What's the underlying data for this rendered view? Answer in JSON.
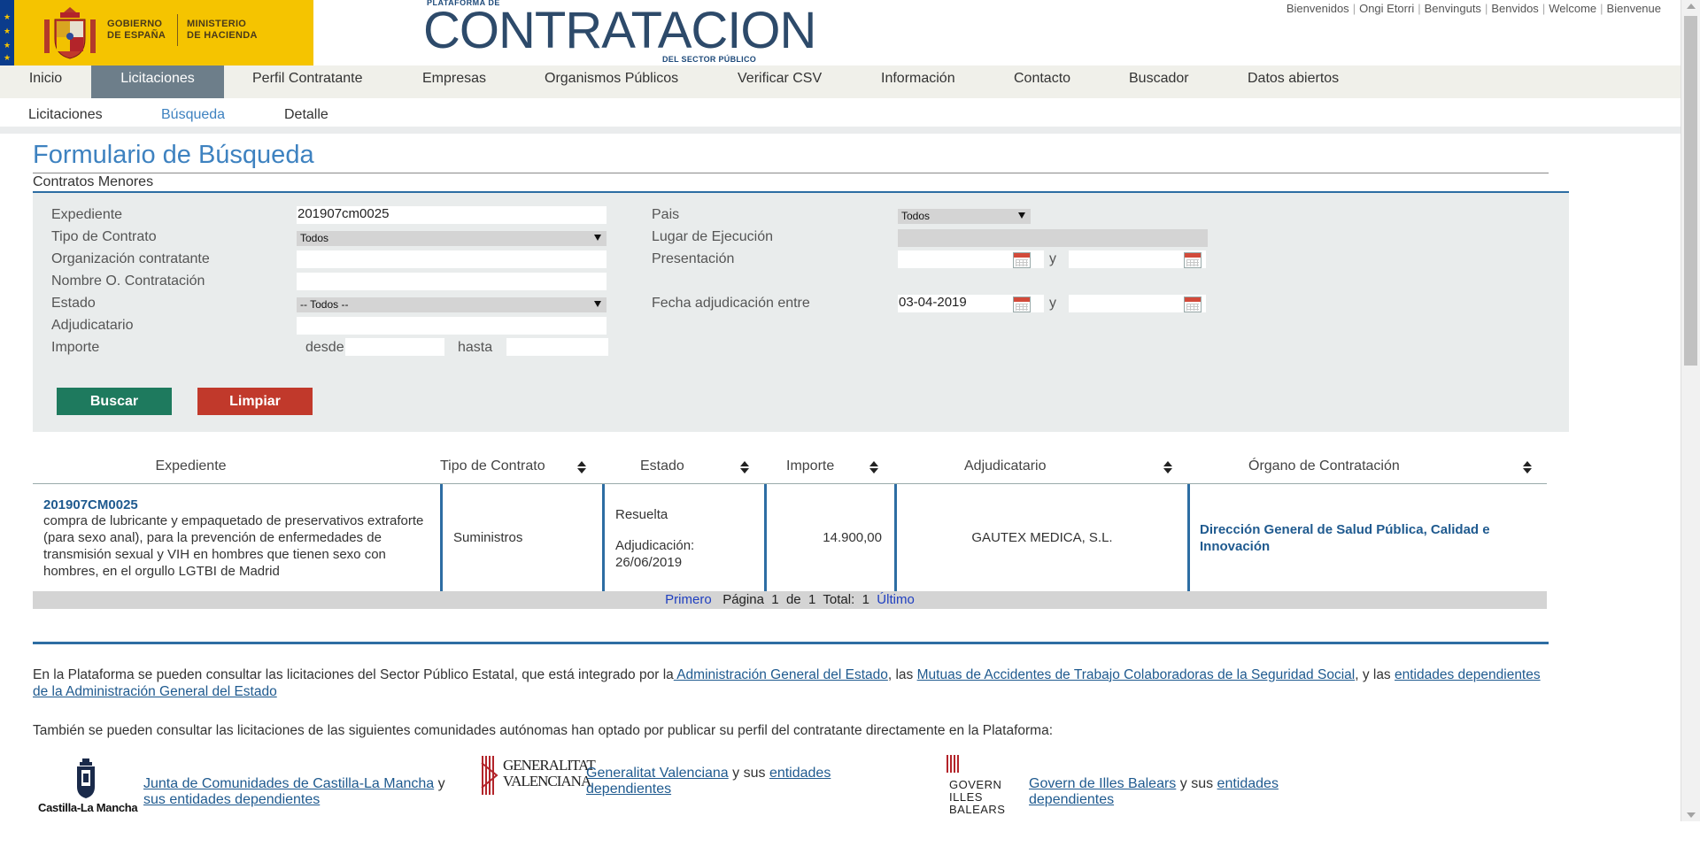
{
  "header": {
    "gov_line1": "GOBIERNO",
    "gov_line2": "DE ESPAÑA",
    "ministry_line1": "MINISTERIO",
    "ministry_line2": "DE HACIENDA",
    "platform_top": "PLATAFORMA DE",
    "platform_main": "CONTRATACION",
    "platform_sub": "DEL SECTOR PÚBLICO",
    "languages": [
      "Bienvenidos",
      "Ongi Etorri",
      "Benvinguts",
      "Benvidos",
      "Welcome",
      "Bienvenue"
    ]
  },
  "main_nav": {
    "items": [
      "Inicio",
      "Licitaciones",
      "Perfil Contratante",
      "Empresas",
      "Organismos Públicos",
      "Verificar CSV",
      "Información",
      "Contacto",
      "Buscador",
      "Datos abiertos"
    ],
    "active": "Licitaciones"
  },
  "sub_nav": {
    "items": [
      "Licitaciones",
      "Búsqueda",
      "Detalle"
    ],
    "active": "Búsqueda"
  },
  "page": {
    "title": "Formulario de Búsqueda",
    "subtitle": "Contratos Menores"
  },
  "form": {
    "expediente_label": "Expediente",
    "expediente_value": "201907cm0025",
    "tipo_contrato_label": "Tipo de Contrato",
    "tipo_contrato_value": "Todos",
    "org_contratante_label": "Organización contratante",
    "org_contratante_value": "",
    "nombre_oc_label": "Nombre O. Contratación",
    "nombre_oc_value": "",
    "estado_label": "Estado",
    "estado_value": "-- Todos --",
    "adjudicatario_label": "Adjudicatario",
    "adjudicatario_value": "",
    "importe_label": "Importe",
    "desde_label": "desde",
    "desde_value": "",
    "hasta_label": "hasta",
    "hasta_value": "",
    "pais_label": "Pais",
    "pais_value": "Todos",
    "lugar_label": "Lugar de Ejecución",
    "presentacion_label": "Presentación",
    "presentacion_from": "",
    "presentacion_to": "",
    "fecha_adj_label": "Fecha adjudicación entre",
    "fecha_adj_from": "03-04-2019",
    "fecha_adj_to": "",
    "y_label": "y",
    "buscar": "Buscar",
    "limpiar": "Limpiar"
  },
  "results": {
    "columns": [
      "Expediente",
      "Tipo de Contrato",
      "Estado",
      "Importe",
      "Adjudicatario",
      "Órgano de Contratación"
    ],
    "rows": [
      {
        "expediente": "201907CM0025",
        "descripcion": "compra de lubricante y empaquetado de preservativos extraforte (para sexo anal), para la prevención de enfermedades de transmisión sexual y VIH en hombres que tienen sexo con hombres, en el orgullo LGTBI de Madrid",
        "tipo": "Suministros",
        "estado": "Resuelta",
        "adjudicacion_label": "Adjudicación:",
        "adjudicacion_fecha": "26/06/2019",
        "importe": "14.900,00",
        "adjudicatario": "GAUTEX MEDICA, S.L.",
        "organo": "Dirección General de Salud Pública, Calidad e Innovación"
      }
    ],
    "pager": {
      "first": "Primero",
      "page_label": "Página",
      "page": "1",
      "of_label": "de",
      "total_pages": "1",
      "total_label": "Total:",
      "total": "1",
      "last": "Último"
    }
  },
  "info": {
    "p1_text1": "En la Plataforma se pueden consultar las licitaciones del Sector Público Estatal, que está integrado por la",
    "p1_link1": " Administración General del Estado",
    "p1_text2": ", las ",
    "p1_link2": "Mutuas de Accidentes de Trabajo Colaboradoras de la Seguridad Social",
    "p1_text3": ", y las ",
    "p1_link3": "entidades dependientes de la Administración General del Estado",
    "p2": "También se pueden consultar las licitaciones de las siguientes comunidades autónomas han optado por publicar su perfil del contratante directamente en la Plataforma:",
    "ccaa": [
      {
        "logo_text": "Castilla-La Mancha",
        "link1": "Junta de Comunidades de Castilla-La Mancha",
        "mid": " y ",
        "link2": "sus entidades dependientes"
      },
      {
        "logo_text_1": "GENERALITAT",
        "logo_text_2": "VALENCIANA",
        "link1": "Generalitat Valenciana",
        "mid": " y sus ",
        "link2": "entidades dependientes"
      },
      {
        "logo_text_1": "GOVERN",
        "logo_text_2": "ILLES",
        "logo_text_3": "BALEARS",
        "link1": "Govern de Illes Balears",
        "mid": " y sus ",
        "link2": "entidades dependientes"
      }
    ]
  },
  "colors": {
    "accent_blue": "#3e82c0",
    "nav_active": "#6d7e8a",
    "buscar_green": "#1e7a5e",
    "limpiar_red": "#c1392b",
    "rule_blue": "#2d6da3"
  }
}
